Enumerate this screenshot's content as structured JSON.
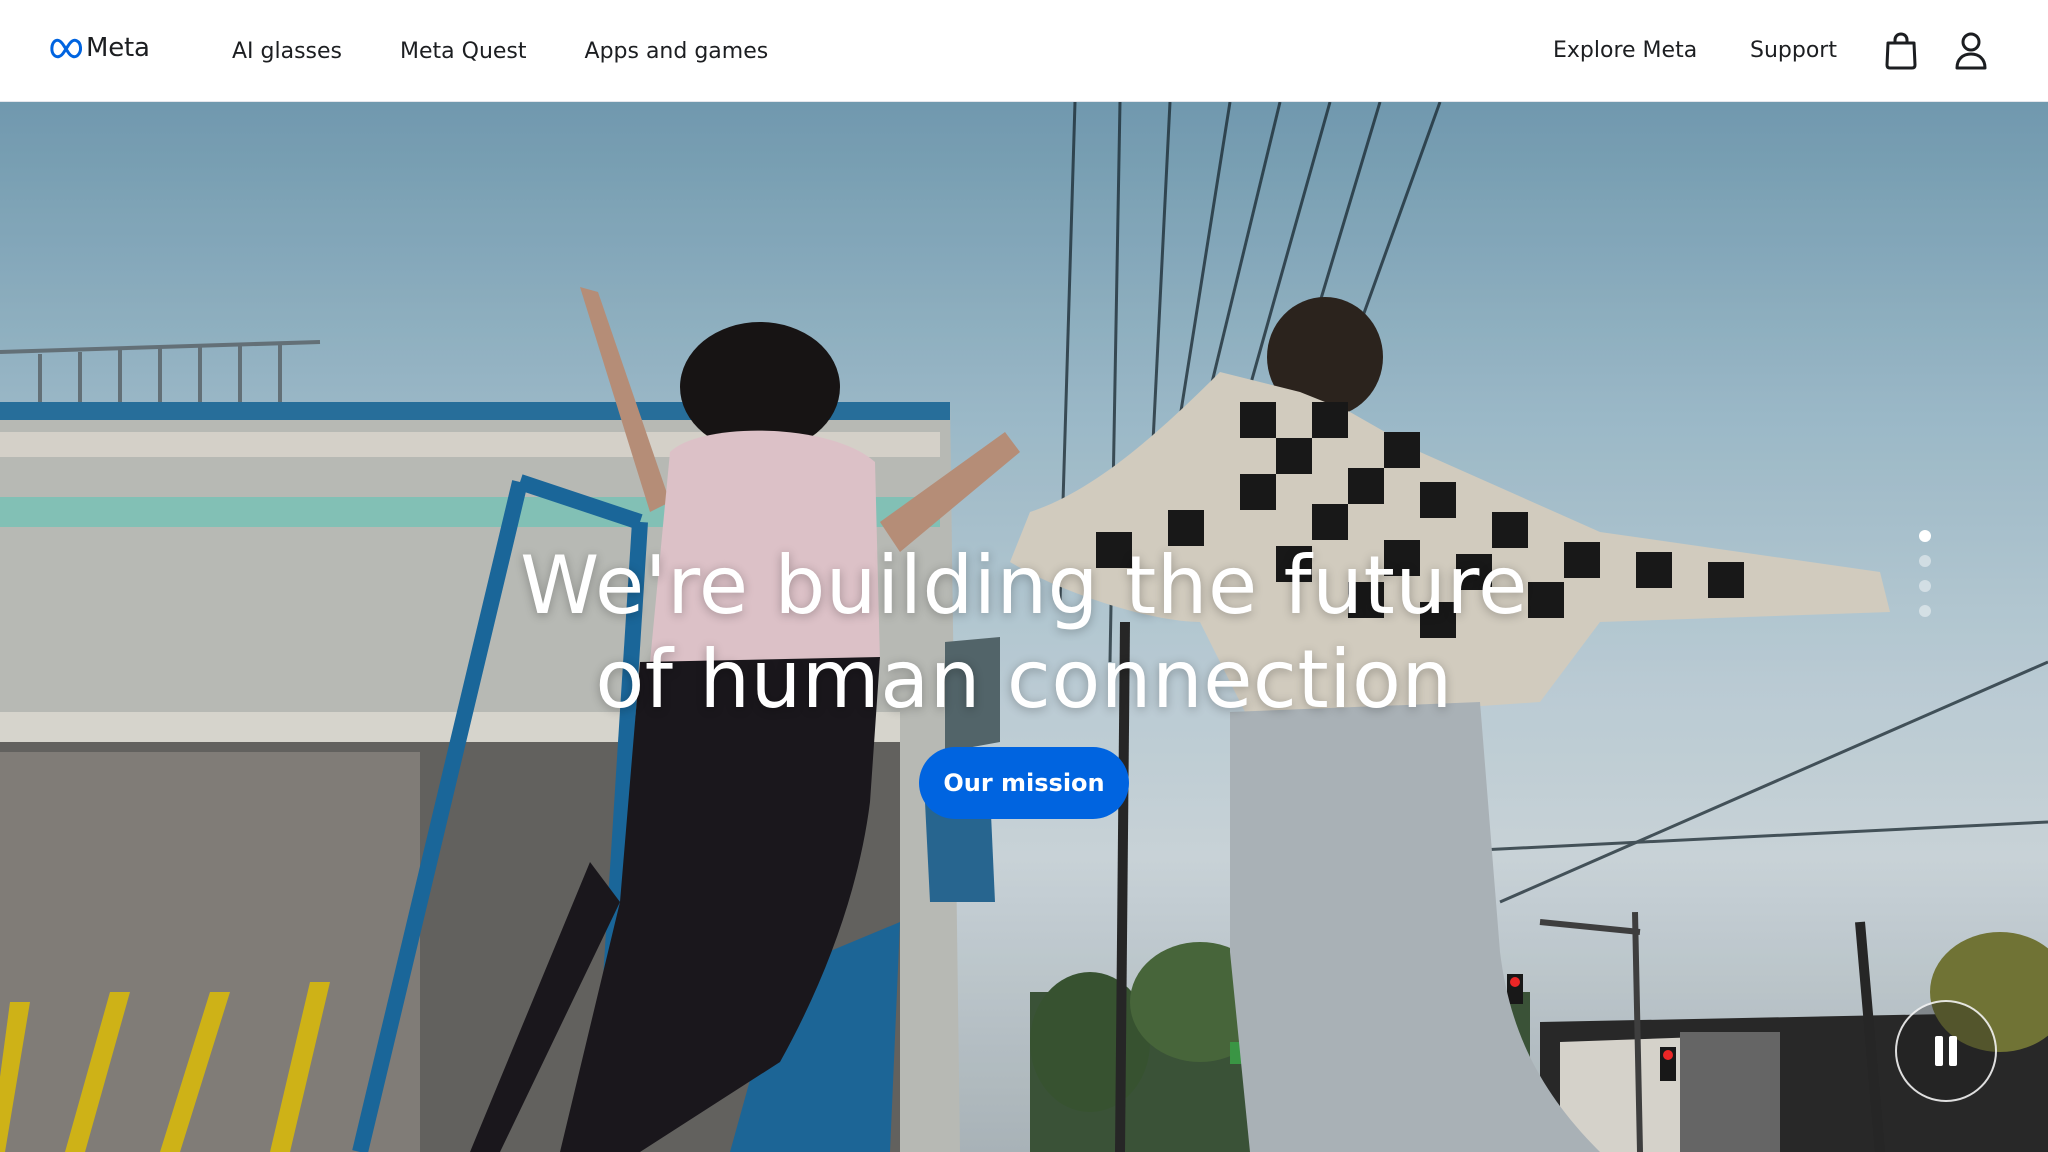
{
  "brand": {
    "name": "Meta",
    "logo_color": "#0064e0"
  },
  "nav": {
    "left_items": [
      {
        "label": "AI glasses"
      },
      {
        "label": "Meta Quest"
      },
      {
        "label": "Apps and games"
      }
    ],
    "right_items": [
      {
        "label": "Explore Meta"
      },
      {
        "label": "Support"
      }
    ],
    "icons": [
      "shopping-bag-icon",
      "user-icon"
    ]
  },
  "hero": {
    "headline_line1": "We're building the future",
    "headline_line2": "of human connection",
    "cta_label": "Our mission",
    "cta_color": "#0064e0",
    "carousel": {
      "total_slides": 4,
      "active_slide": 1
    },
    "media_control": "pause-icon"
  }
}
